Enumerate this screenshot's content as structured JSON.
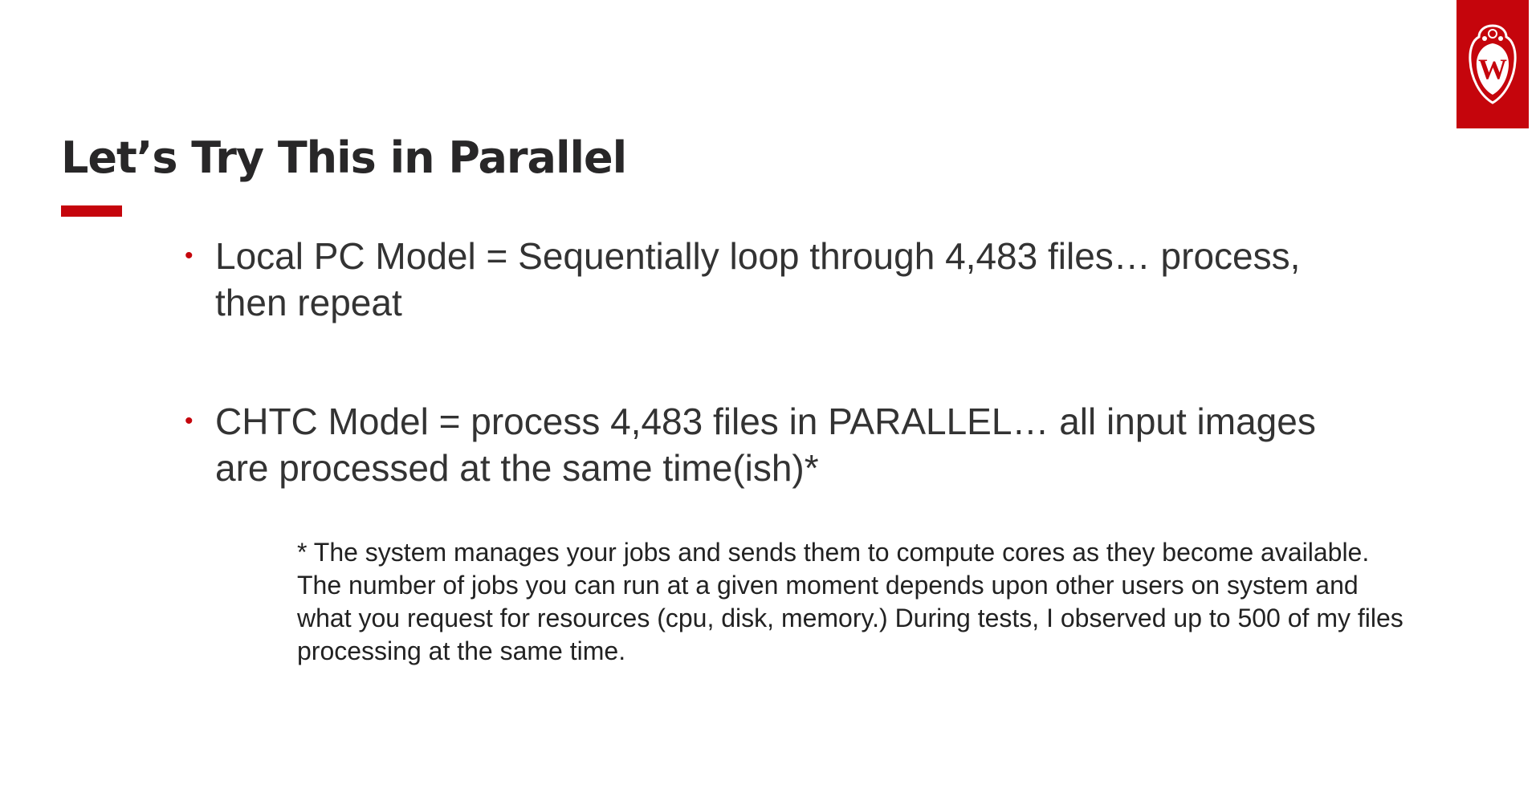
{
  "slide": {
    "title": "Let’s Try This in Parallel",
    "bullet_glyph": "•",
    "bullets": [
      {
        "text": "Local PC Model = Sequentially loop through 4,483 files… process, then repeat"
      },
      {
        "text": "CHTC Model = process 4,483 files in PARALLEL… all input images are processed at the same time(ish)*"
      }
    ],
    "footnote": "* The system manages your jobs and sends them to compute cores as they become available.  The number of jobs you can run at a given moment depends upon other users on system and what you request for resources (cpu, disk, memory.)   During tests, I observed up to 500 of my files processing at the same time."
  },
  "logo": {
    "letter": "W",
    "icon": "uw-crest-icon"
  },
  "colors": {
    "accent": "#c5050c",
    "title_text": "#282728",
    "body_text": "#333333",
    "background": "#ffffff"
  }
}
